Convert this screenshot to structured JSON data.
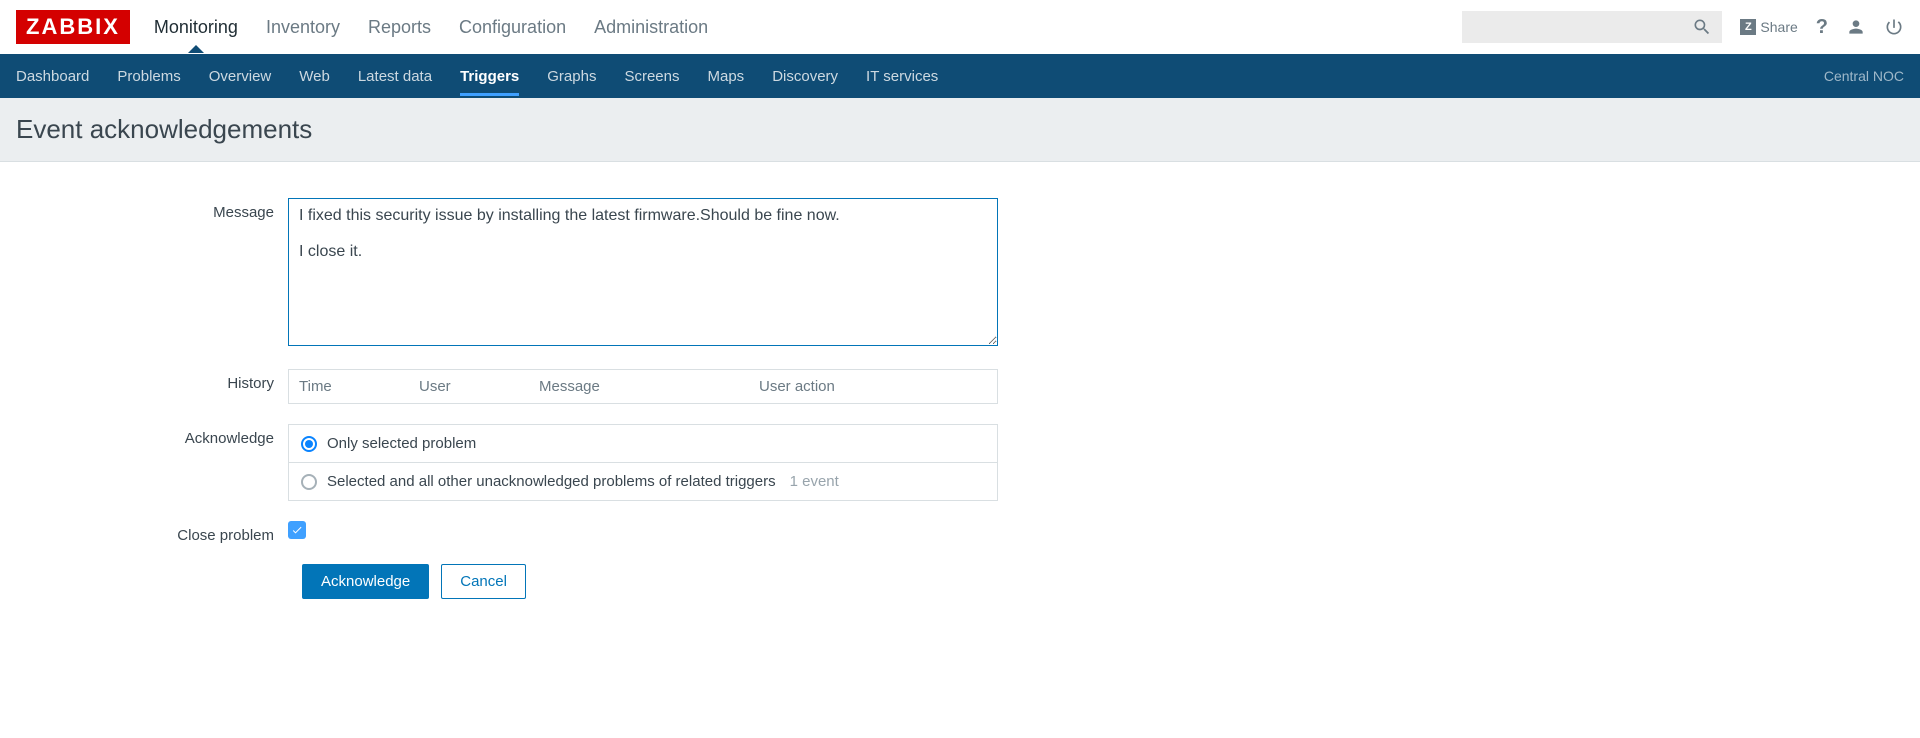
{
  "logo": "ZABBIX",
  "topnav": {
    "items": [
      {
        "label": "Monitoring",
        "active": true
      },
      {
        "label": "Inventory"
      },
      {
        "label": "Reports"
      },
      {
        "label": "Configuration"
      },
      {
        "label": "Administration"
      }
    ]
  },
  "topright": {
    "share_label": "Share"
  },
  "subnav": {
    "items": [
      {
        "label": "Dashboard"
      },
      {
        "label": "Problems"
      },
      {
        "label": "Overview"
      },
      {
        "label": "Web"
      },
      {
        "label": "Latest data"
      },
      {
        "label": "Triggers",
        "active": true
      },
      {
        "label": "Graphs"
      },
      {
        "label": "Screens"
      },
      {
        "label": "Maps"
      },
      {
        "label": "Discovery"
      },
      {
        "label": "IT services"
      }
    ],
    "right": "Central NOC"
  },
  "page": {
    "title": "Event acknowledgements"
  },
  "form": {
    "message_label": "Message",
    "message_value": "I fixed this security issue by installing the latest firmware.Should be fine now.\n\nI close it.",
    "history_label": "History",
    "history_columns": {
      "time": "Time",
      "user": "User",
      "message": "Message",
      "action": "User action"
    },
    "ack_label": "Acknowledge",
    "ack_options": [
      {
        "label": "Only selected problem",
        "checked": true
      },
      {
        "label": "Selected and all other unacknowledged problems of related triggers",
        "hint": "1 event"
      }
    ],
    "close_label": "Close problem",
    "close_checked": true,
    "buttons": {
      "ack": "Acknowledge",
      "cancel": "Cancel"
    }
  }
}
